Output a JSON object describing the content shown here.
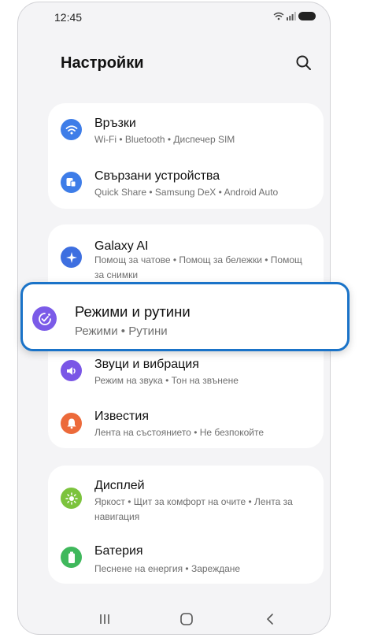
{
  "status": {
    "time": "12:45"
  },
  "header": {
    "title": "Настройки"
  },
  "groups": [
    {
      "items": [
        {
          "title": "Връзки",
          "subtitle": "Wi-Fi  •  Bluetooth  •  Диспечер SIM",
          "icon": "wifi-icon",
          "color": "#3e7de8"
        },
        {
          "title": "Свързани устройства",
          "subtitle": "Quick Share  •  Samsung DeX  •  Android Auto",
          "icon": "connected-devices-icon",
          "color": "#3e7de8"
        }
      ]
    },
    {
      "items": [
        {
          "title": "Galaxy AI",
          "subtitle": "Помощ за чатове  •  Помощ за бележки  •  Помощ за снимки",
          "icon": "sparkle-icon",
          "color": "#3e6fe0"
        },
        {
          "title": "Звуци и вибрация",
          "subtitle": "Режим на звука  •  Тон на звънене",
          "icon": "speaker-icon",
          "color": "#7a56e6"
        },
        {
          "title": "Известия",
          "subtitle": "Лента на състоянието  •  Не безпокойте",
          "icon": "bell-icon",
          "color": "#ec6a3a"
        }
      ]
    },
    {
      "items": [
        {
          "title": "Дисплей",
          "subtitle": "Яркост  •  Щит за комфорт на очите  •  Лента за навигация",
          "icon": "sun-icon",
          "color": "#7cc33d"
        },
        {
          "title": "Батерия",
          "subtitle": "Песнене на енергия  •  Зареждане",
          "icon": "battery-icon",
          "color": "#3fb85c"
        }
      ]
    }
  ],
  "highlighted": {
    "title": "Режими и рутини",
    "subtitle": "Режими  •  Рутини",
    "icon": "modes-routines-icon",
    "color": "#7b5be8",
    "border_color": "#1a73c8"
  },
  "navbar": {
    "recents": "recents-icon",
    "home": "home-icon",
    "back": "back-icon"
  }
}
